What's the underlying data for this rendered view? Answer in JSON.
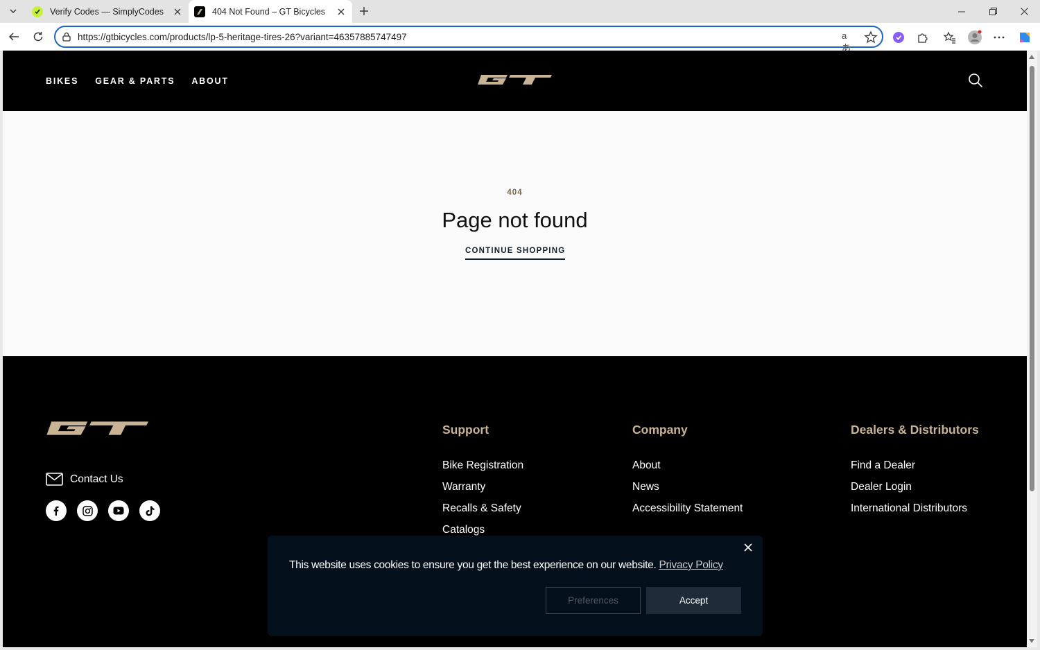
{
  "browser": {
    "tabs": [
      {
        "title": "Verify Codes — SimplyCodes",
        "active": false
      },
      {
        "title": "404 Not Found – GT Bicycles",
        "active": true
      }
    ],
    "url": "https://gtbicycles.com/products/lp-5-heritage-tires-26?variant=46357885747497",
    "read_aloud_glyph": "aあ"
  },
  "site": {
    "nav": [
      "BIKES",
      "GEAR & PARTS",
      "ABOUT"
    ],
    "colors": {
      "brand_gold": "#c8b394",
      "header_bg": "#000000",
      "page_bg": "#fafafa"
    }
  },
  "error": {
    "code": "404",
    "title": "Page not found",
    "cta": "CONTINUE SHOPPING"
  },
  "footer": {
    "contact_label": "Contact Us",
    "socials": [
      "facebook-icon",
      "instagram-icon",
      "youtube-icon",
      "tiktok-icon"
    ],
    "columns": [
      {
        "heading": "Support",
        "links": [
          "Bike Registration",
          "Warranty",
          "Recalls & Safety",
          "Catalogs"
        ]
      },
      {
        "heading": "Company",
        "links": [
          "About",
          "News",
          "Accessibility Statement"
        ]
      },
      {
        "heading": "Dealers & Distributors",
        "links": [
          "Find a Dealer",
          "Dealer Login",
          "International Distributors"
        ]
      }
    ]
  },
  "cookie": {
    "message": "This website uses cookies to ensure you get the best experience on our website.",
    "policy_link": "Privacy Policy",
    "preferences_label": "Preferences",
    "accept_label": "Accept"
  }
}
